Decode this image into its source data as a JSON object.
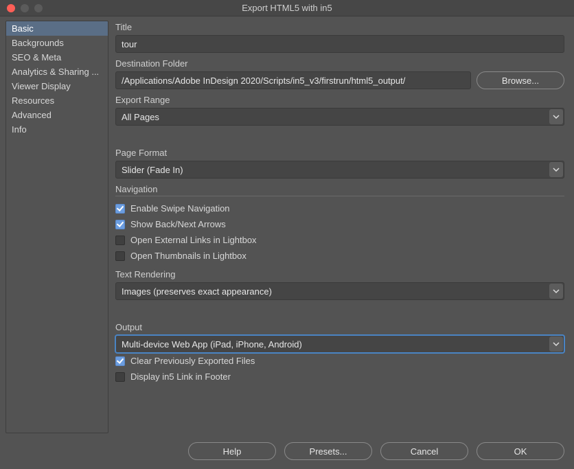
{
  "window": {
    "title": "Export HTML5 with in5"
  },
  "sidebar": {
    "items": [
      "Basic",
      "Backgrounds",
      "SEO & Meta",
      "Analytics & Sharing ...",
      "Viewer Display",
      "Resources",
      "Advanced",
      "Info"
    ],
    "selected_index": 0
  },
  "labels": {
    "title": "Title",
    "dest_folder": "Destination Folder",
    "browse": "Browse...",
    "export_range": "Export Range",
    "page_format": "Page Format",
    "navigation": "Navigation",
    "text_rendering": "Text Rendering",
    "output": "Output"
  },
  "values": {
    "title": "tour",
    "dest_folder": "/Applications/Adobe InDesign 2020/Scripts/in5_v3/firstrun/html5_output/",
    "export_range": "All Pages",
    "page_format": "Slider (Fade In)",
    "text_rendering": "Images (preserves exact appearance)",
    "output": "Multi-device Web App (iPad, iPhone, Android)"
  },
  "nav_checks": {
    "swipe": {
      "label": "Enable Swipe Navigation",
      "checked": true
    },
    "arrows": {
      "label": "Show Back/Next Arrows",
      "checked": true
    },
    "extlinks": {
      "label": "Open External Links in Lightbox",
      "checked": false
    },
    "thumbs": {
      "label": "Open Thumbnails in Lightbox",
      "checked": false
    }
  },
  "output_checks": {
    "clear": {
      "label": "Clear Previously Exported Files",
      "checked": true
    },
    "footer": {
      "label": "Display in5 Link in Footer",
      "checked": false
    }
  },
  "footer": {
    "help": "Help",
    "presets": "Presets...",
    "cancel": "Cancel",
    "ok": "OK"
  }
}
